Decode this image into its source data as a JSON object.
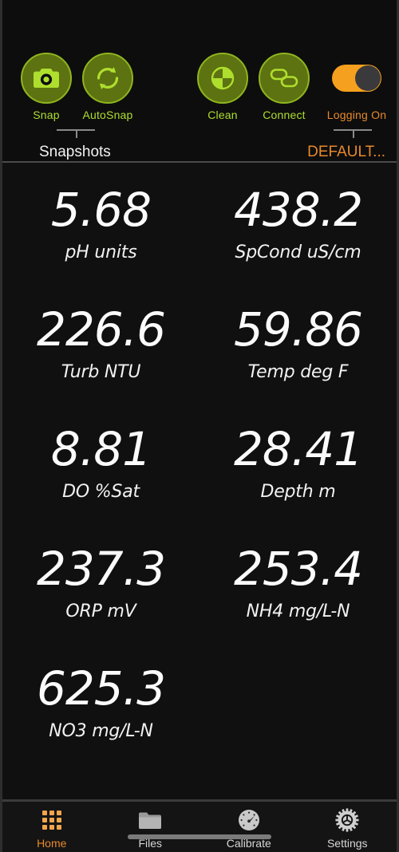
{
  "toolbar": {
    "tools": [
      {
        "label": "Snap",
        "icon": "camera-icon",
        "type": "circle",
        "color": "#aede2e"
      },
      {
        "label": "AutoSnap",
        "icon": "refresh-sync-icon",
        "type": "circle",
        "color": "#aede2e"
      },
      {
        "label": "Clean",
        "icon": "wiper-quadrant-icon",
        "type": "circle",
        "color": "#aede2e"
      },
      {
        "label": "Connect",
        "icon": "link-chain-icon",
        "type": "circle",
        "color": "#aede2e"
      },
      {
        "label": "Logging On",
        "icon": "toggle-switch-on",
        "type": "toggle",
        "color": "#e8892b"
      }
    ],
    "groups": [
      {
        "label": "Snapshots",
        "color": "#f2f2f2"
      },
      {
        "label": "DEFAULT...",
        "color": "#e8892b"
      }
    ]
  },
  "readings": [
    {
      "value": "5.68",
      "unit": "pH units"
    },
    {
      "value": "438.2",
      "unit": "SpCond uS/cm"
    },
    {
      "value": "226.6",
      "unit": "Turb NTU"
    },
    {
      "value": "59.86",
      "unit": "Temp deg F"
    },
    {
      "value": "8.81",
      "unit": "DO %Sat"
    },
    {
      "value": "28.41",
      "unit": "Depth m"
    },
    {
      "value": "237.3",
      "unit": "ORP mV"
    },
    {
      "value": "253.4",
      "unit": "NH4 mg/L-N"
    },
    {
      "value": "625.3",
      "unit": "NO3 mg/L-N"
    }
  ],
  "bottom_nav": {
    "items": [
      {
        "label": "Home",
        "icon": "grid-apps-icon",
        "active": true
      },
      {
        "label": "Files",
        "icon": "folder-icon",
        "active": false
      },
      {
        "label": "Calibrate",
        "icon": "gauge-icon",
        "active": false
      },
      {
        "label": "Settings",
        "icon": "gear-icon",
        "active": false
      }
    ],
    "active_color": "#e8892b",
    "inactive_color": "#d8d8d8"
  }
}
